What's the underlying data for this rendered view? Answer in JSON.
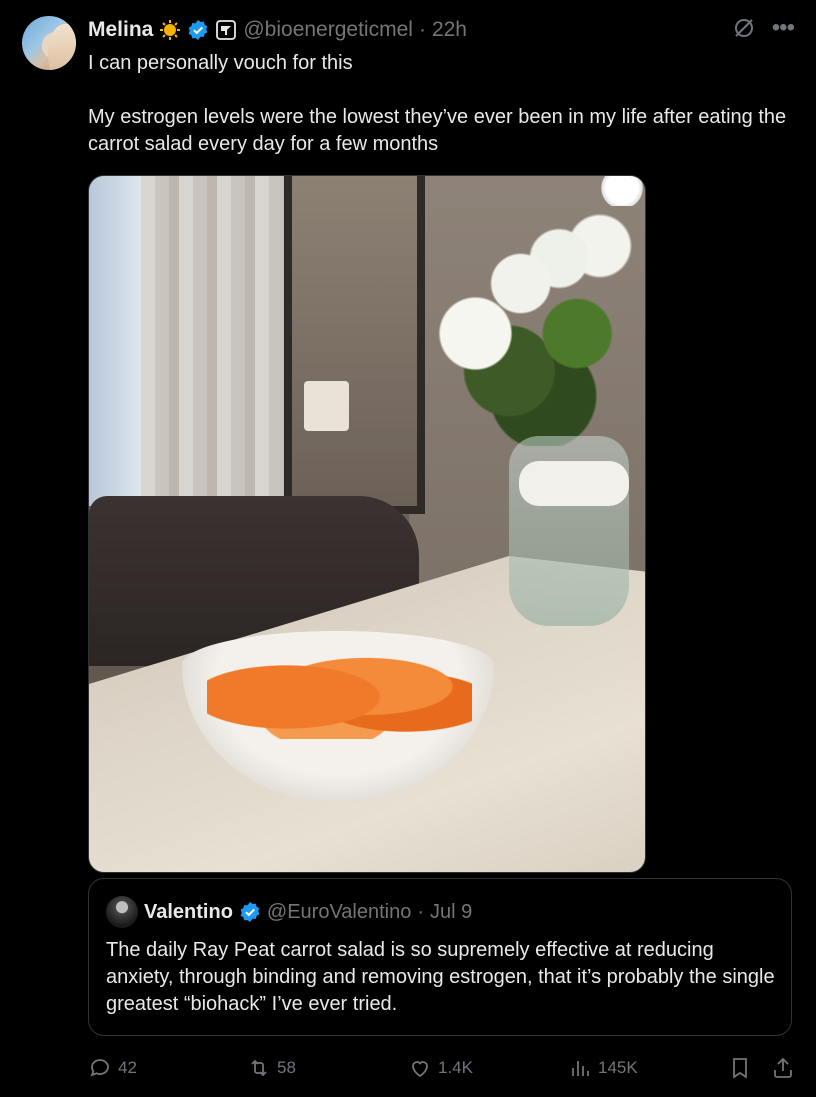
{
  "tweet": {
    "display_name": "Melina",
    "handle": "@bioenergeticmel",
    "separator": "·",
    "time": "22h",
    "paragraphs": [
      "I can personally vouch for this",
      "My estrogen levels were the lowest they’ve ever been in my life after eating the carrot salad every day for a few months"
    ]
  },
  "quote": {
    "display_name": "Valentino",
    "handle": "@EuroValentino",
    "separator": "·",
    "date": "Jul 9",
    "text": "The daily Ray Peat carrot salad is so supremely effective at reducing anxiety, through binding and removing estrogen, that it’s probably the single greatest “biohack” I’ve ever tried."
  },
  "actions": {
    "replies": "42",
    "reposts": "58",
    "likes": "1.4K",
    "views": "145K"
  },
  "icons": {
    "badges": [
      "sun-emoji-icon",
      "verified-icon",
      "affiliate-icon"
    ],
    "top_right": [
      "grok-icon",
      "more-icon"
    ],
    "action_bar": [
      "reply-icon",
      "repost-icon",
      "like-icon",
      "views-icon",
      "bookmark-icon",
      "share-icon"
    ]
  },
  "colors": {
    "background": "#000000",
    "text": "#e7e9ea",
    "muted": "#71767b",
    "verified": "#1d9bf0",
    "border": "#2f3336"
  }
}
